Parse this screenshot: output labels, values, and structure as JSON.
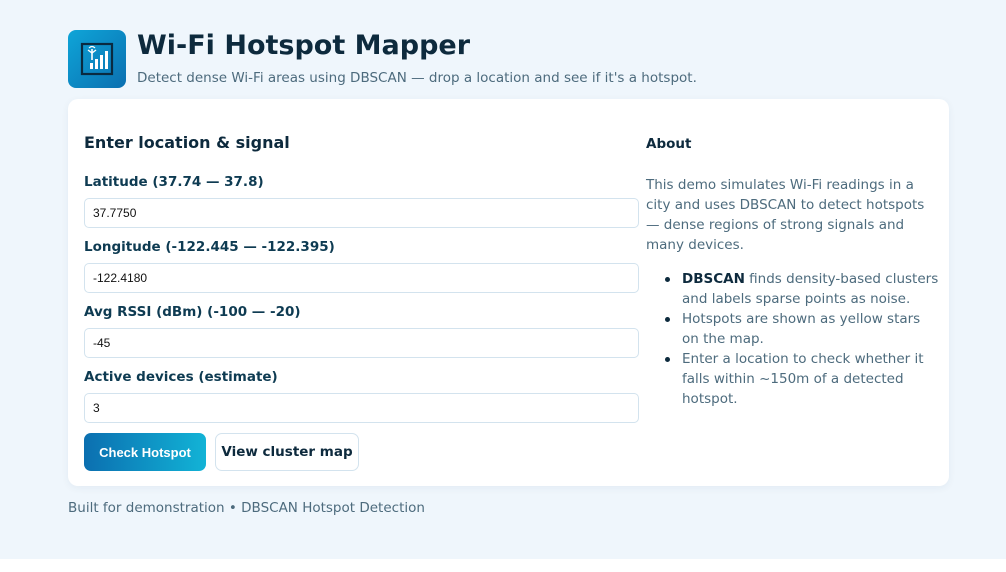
{
  "header": {
    "title": "Wi-Fi Hotspot Mapper",
    "subtitle": "Detect dense Wi-Fi areas using DBSCAN — drop a location and see if it's a hotspot.",
    "logo_icon": "wifi-signal-icon",
    "logo_colors": [
      "#0ea5d8",
      "#0b6fb0"
    ]
  },
  "form": {
    "title": "Enter location & signal",
    "latitude": {
      "label": "Latitude (37.74 — 37.8)",
      "value": "37.7750"
    },
    "longitude": {
      "label": "Longitude (-122.445 — -122.395)",
      "value": "-122.4180"
    },
    "rssi": {
      "label": "Avg RSSI (dBm) (-100 — -20)",
      "value": "-45"
    },
    "devices": {
      "label": "Active devices (estimate)",
      "value": "3"
    },
    "check_button": "Check Hotspot",
    "map_button": "View cluster map"
  },
  "about": {
    "title": "About",
    "text": "This demo simulates Wi-Fi readings in a city and uses DBSCAN to detect hotspots — dense regions of strong signals and many devices.",
    "items": [
      {
        "bold": "DBSCAN",
        "text": " finds density-based clusters and labels sparse points as noise."
      },
      {
        "bold": "",
        "text": "Hotspots are shown as yellow stars on the map."
      },
      {
        "bold": "",
        "text": "Enter a location to check whether it falls within ~150m of a detected hotspot."
      }
    ]
  },
  "footer": "Built for demonstration • DBSCAN Hotspot Detection",
  "colors": {
    "page_bg": "#eff6fc",
    "accent": "#0b6fb0",
    "accent_light": "#12b3d6",
    "heading": "#0d2a3d",
    "muted": "#4d6b7d"
  }
}
